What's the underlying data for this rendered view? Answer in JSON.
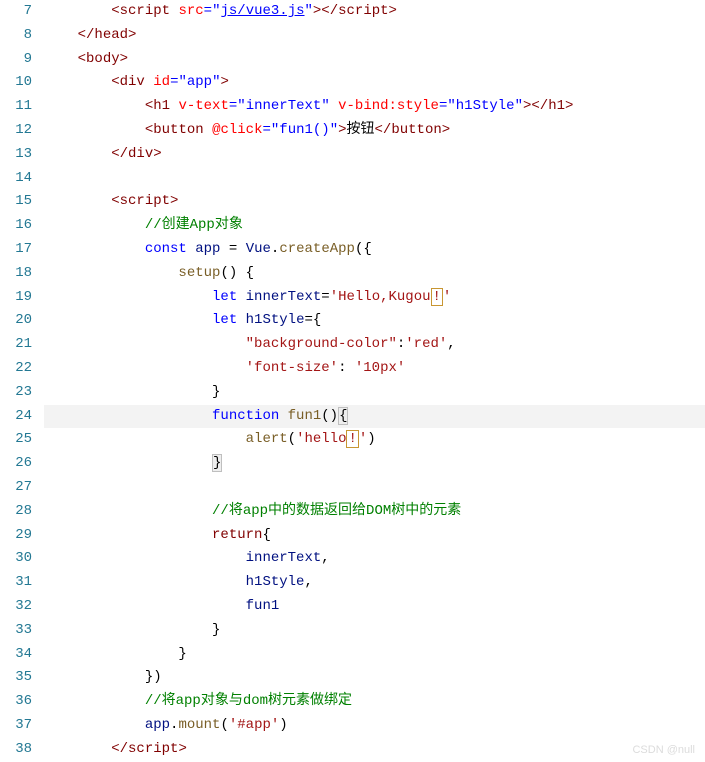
{
  "gutter": {
    "start": 7,
    "end": 38
  },
  "highlight_line": 24,
  "watermark": "CSDN @null",
  "tokens": {
    "l7": {
      "in": "        ",
      "a": "<",
      "b": "script",
      "c": " ",
      "d": "src",
      "e": "=\"",
      "f": "js/vue3.js",
      "g": "\"",
      "h": "></",
      "i": "script",
      "j": ">"
    },
    "l8": {
      "in": "    ",
      "a": "</",
      "b": "head",
      "c": ">"
    },
    "l9": {
      "in": "    ",
      "a": "<",
      "b": "body",
      "c": ">"
    },
    "l10": {
      "in": "        ",
      "a": "<",
      "b": "div",
      "c": " ",
      "d": "id",
      "e": "=\"",
      "f": "app",
      "g": "\"",
      "h": ">"
    },
    "l11": {
      "in": "            ",
      "a": "<",
      "b": "h1",
      "c": " ",
      "d": "v-text",
      "e": "=\"",
      "f": "innerText",
      "g": "\"",
      "h": " ",
      "i": "v-bind:style",
      "j": "=\"",
      "k": "h1Style",
      "l": "\"",
      "m": "></",
      "n": "h1",
      "o": ">"
    },
    "l12": {
      "in": "            ",
      "a": "<",
      "b": "button",
      "c": " ",
      "d": "@click",
      "e": "=\"",
      "f": "fun1()",
      "g": "\"",
      "h": ">",
      "i": "按钮",
      "j": "</",
      "k": "button",
      "l": ">"
    },
    "l13": {
      "in": "        ",
      "a": "</",
      "b": "div",
      "c": ">"
    },
    "l14": {
      "in": ""
    },
    "l15": {
      "in": "        ",
      "a": "<",
      "b": "script",
      "c": ">"
    },
    "l16": {
      "in": "            ",
      "a": "//创建App对象"
    },
    "l17": {
      "in": "            ",
      "a": "const",
      "b": " ",
      "c": "app",
      "d": " = ",
      "e": "Vue",
      "f": ".",
      "g": "createApp",
      "h": "({"
    },
    "l18": {
      "in": "                ",
      "a": "setup",
      "b": "() {"
    },
    "l19": {
      "in": "                    ",
      "a": "let",
      "b": " ",
      "c": "innerText",
      "d": "=",
      "e": "'Hello,Kugou",
      "f": "!",
      "g": "'"
    },
    "l20": {
      "in": "                    ",
      "a": "let",
      "b": " ",
      "c": "h1Style",
      "d": "={"
    },
    "l21": {
      "in": "                        ",
      "a": "\"background-color\"",
      "b": ":",
      "c": "'red'",
      "d": ","
    },
    "l22": {
      "in": "                        ",
      "a": "'font-size'",
      "b": ": ",
      "c": "'10px'"
    },
    "l23": {
      "in": "                    ",
      "a": "}"
    },
    "l24": {
      "in": "                    ",
      "a": "function",
      "b": " ",
      "c": "fun1",
      "d": "()",
      "e": "{"
    },
    "l25": {
      "in": "                        ",
      "a": "alert",
      "b": "(",
      "c": "'hello",
      "d": "!",
      "e": "'",
      "f": ")"
    },
    "l26": {
      "in": "                    ",
      "a": "}"
    },
    "l27": {
      "in": ""
    },
    "l28": {
      "in": "                    ",
      "a": "//将app中的数据返回给DOM树中的元素"
    },
    "l29": {
      "in": "                    ",
      "a": "return",
      "b": "{"
    },
    "l30": {
      "in": "                        ",
      "a": "innerText",
      "b": ","
    },
    "l31": {
      "in": "                        ",
      "a": "h1Style",
      "b": ","
    },
    "l32": {
      "in": "                        ",
      "a": "fun1"
    },
    "l33": {
      "in": "                    ",
      "a": "}"
    },
    "l34": {
      "in": "                ",
      "a": "}"
    },
    "l35": {
      "in": "            ",
      "a": "})"
    },
    "l36": {
      "in": "            ",
      "a": "//将app对象与dom树元素做绑定"
    },
    "l37": {
      "in": "            ",
      "a": "app",
      "b": ".",
      "c": "mount",
      "d": "(",
      "e": "'#app'",
      "f": ")"
    },
    "l38": {
      "in": "        ",
      "a": "</",
      "b": "script",
      "c": ">"
    }
  }
}
